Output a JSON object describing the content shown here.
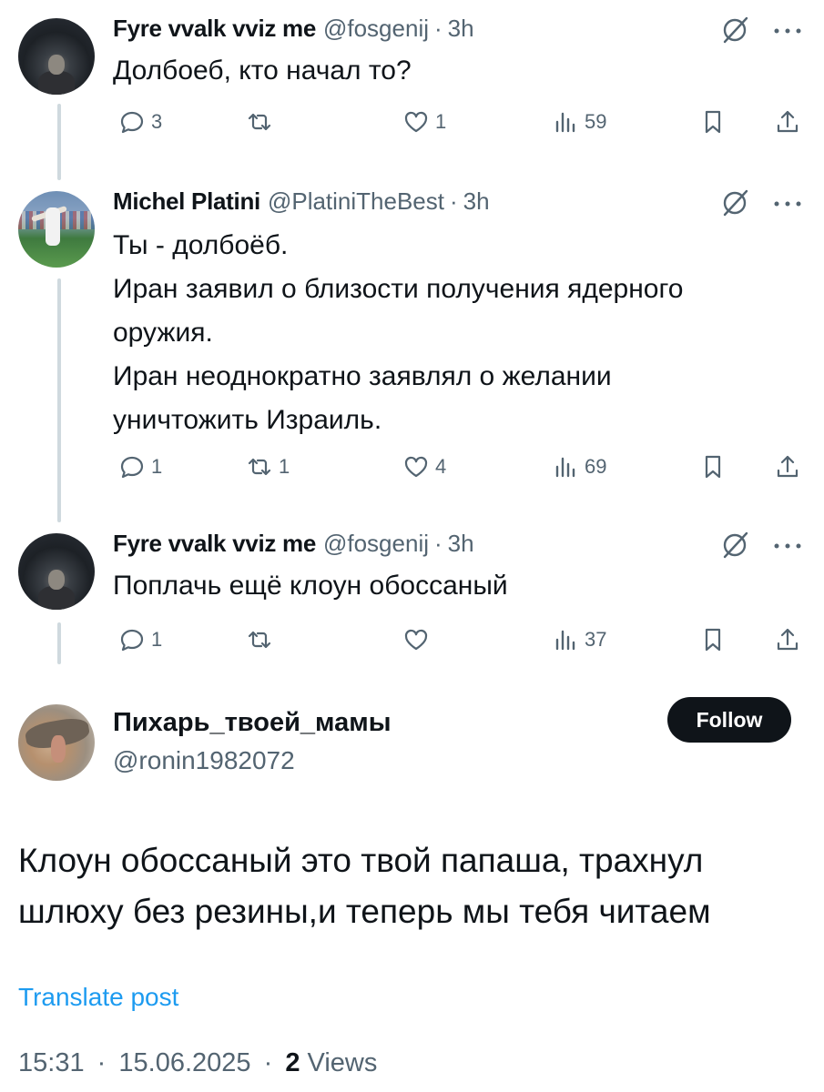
{
  "colors": {
    "text": "#0f1419",
    "secondary": "#536471",
    "link": "#1d9bf0",
    "thread": "#cfd9de",
    "follow_bg": "#0f1419",
    "follow_text": "#ffffff"
  },
  "replies": [
    {
      "display_name": "Fyre vvalk vviz me",
      "handle": "@fosgenij",
      "separator": "·",
      "time": "3h",
      "text": "Долбоеб, кто начал то?",
      "stats": {
        "replies": "3",
        "reposts": "",
        "likes": "1",
        "views": "59"
      }
    },
    {
      "display_name": "Michel Platini",
      "handle": "@PlatiniTheBest",
      "separator": "·",
      "time": "3h",
      "text": "Ты - долбоёб.\nИран заявил о близости получения ядерного оружия.\nИран неоднократно заявлял о желании уничтожить Израиль.",
      "stats": {
        "replies": "1",
        "reposts": "1",
        "likes": "4",
        "views": "69"
      }
    },
    {
      "display_name": "Fyre vvalk vviz me",
      "handle": "@fosgenij",
      "separator": "·",
      "time": "3h",
      "text": "Поплачь ещё клоун обоссаный",
      "stats": {
        "replies": "1",
        "reposts": "",
        "likes": "",
        "views": "37"
      }
    }
  ],
  "main_post": {
    "display_name": "Пихарь_твоей_мамы",
    "handle": "@ronin1982072",
    "follow_label": "Follow",
    "text": "Клоун обоссаный это твой папаша, трахнул шлюху без резины,и теперь мы тебя читаем",
    "translate_label": "Translate post",
    "time": "15:31",
    "separator": "·",
    "date": "15.06.2025",
    "views_count": "2",
    "views_label": "Views"
  },
  "icons": [
    "reply-icon",
    "repost-icon",
    "like-icon",
    "views-icon",
    "bookmark-icon",
    "share-icon",
    "grok-icon",
    "more-icon"
  ]
}
